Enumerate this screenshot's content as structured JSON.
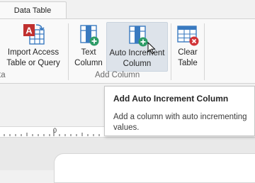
{
  "tabs": {
    "active_label": "Data Table"
  },
  "ribbon": {
    "import_access": {
      "line1": "Import Access",
      "line2": "Table or Query"
    },
    "text_column": {
      "line1": "Text",
      "line2": "Column"
    },
    "auto_increment": {
      "line1": "Auto Increment",
      "line2": "Column"
    },
    "clear_table": {
      "line1": "Clear",
      "line2": "Table"
    },
    "group_left_partial": "ta",
    "group_add_column": "Add Column"
  },
  "tooltip": {
    "title": "Add Auto Increment Column",
    "description": "Add a column with auto incrementing values."
  },
  "ruler": {
    "zero_label": "0"
  },
  "colors": {
    "accent_green": "#2e9c67",
    "accent_red": "#d13438",
    "accent_blue": "#3a7ac0",
    "hover_bg": "#dde3ea"
  },
  "icons": {
    "import_access": "access-import-icon",
    "text_column": "text-column-add-icon",
    "auto_increment": "auto-increment-column-add-icon",
    "clear_table": "clear-table-icon",
    "cursor": "mouse-pointer-icon"
  }
}
